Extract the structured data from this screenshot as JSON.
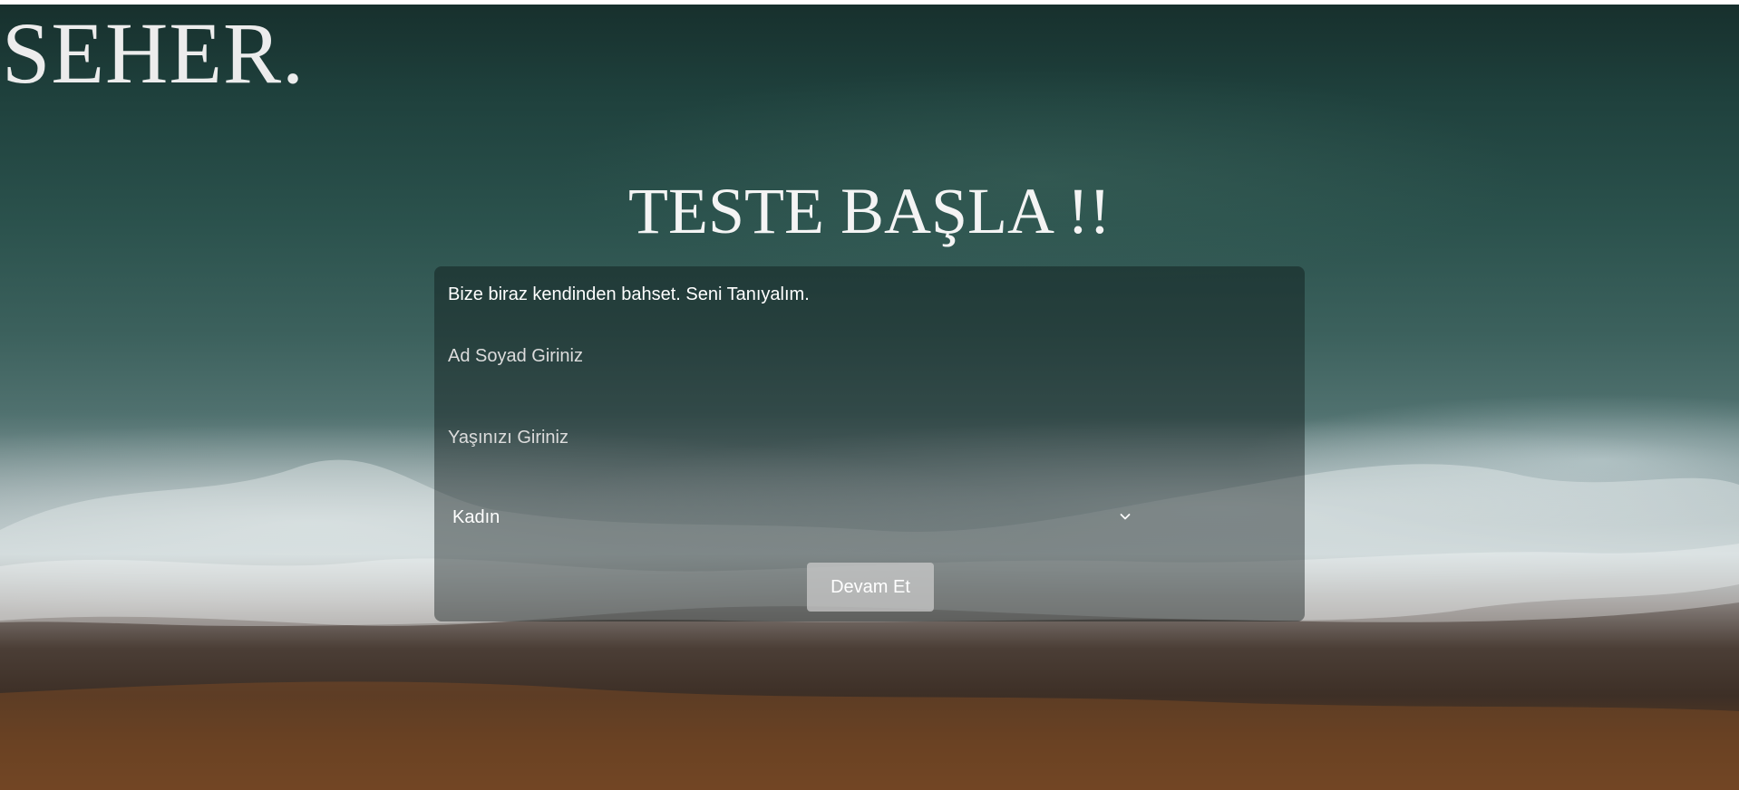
{
  "brand": {
    "logo_text": "SEHER."
  },
  "hero": {
    "title": "TESTE BAŞLA !!"
  },
  "form": {
    "intro": "Bize biraz kendinden bahset. Seni Tanıyalım.",
    "name_placeholder": "Ad Soyad Giriniz",
    "age_placeholder": "Yaşınızı Giriniz",
    "gender_selected": "Kadın",
    "submit_label": "Devam Et"
  },
  "icons": {
    "select_arrow": "chevron-down-icon"
  },
  "colors": {
    "text": "#ffffff",
    "card_bg": "rgba(10,20,20,0.42)",
    "button_bg": "rgba(205,205,205,0.72)"
  }
}
